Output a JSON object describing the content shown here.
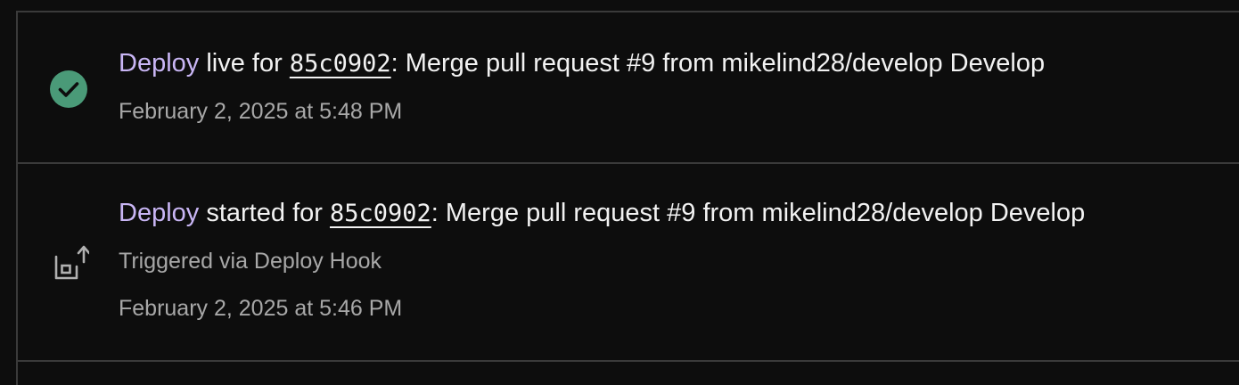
{
  "events": [
    {
      "type": "deploy-live",
      "link_text": "Deploy",
      "status_text": "live",
      "for_text": "for",
      "commit": "85c0902",
      "message": ": Merge pull request #9 from mikelind28/develop Develop",
      "timestamp": "February 2, 2025 at 5:48 PM",
      "icon": "check-circle-icon"
    },
    {
      "type": "deploy-started",
      "link_text": "Deploy",
      "status_text": "started",
      "for_text": "for",
      "commit": "85c0902",
      "message": ": Merge pull request #9 from mikelind28/develop Develop",
      "trigger": "Triggered via Deploy Hook",
      "timestamp": "February 2, 2025 at 5:46 PM",
      "icon": "deploy-hook-icon"
    }
  ],
  "colors": {
    "background": "#0d0d0d",
    "link": "#c9b6f5",
    "success": "#4a9a78",
    "muted_text": "#a8a8a8",
    "divider": "#3a3a3a"
  }
}
